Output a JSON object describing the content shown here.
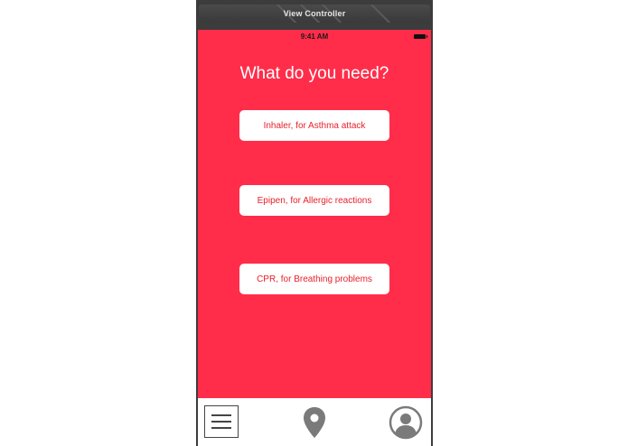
{
  "scene": {
    "title": "View Controller"
  },
  "status_bar": {
    "time": "9:41 AM"
  },
  "main": {
    "title": "What do you need?",
    "buttons": [
      {
        "label": "Inhaler, for Asthma attack"
      },
      {
        "label": "Epipen, for Allergic reactions"
      },
      {
        "label": "CPR, for Breathing problems"
      }
    ]
  },
  "tab_bar": {
    "items": [
      {
        "icon": "hamburger-menu-icon"
      },
      {
        "icon": "map-pin-icon"
      },
      {
        "icon": "user-profile-icon"
      }
    ]
  },
  "colors": {
    "background": "#ff2d4a",
    "button_text": "#e8202a",
    "button_bg": "#ffffff",
    "tab_icon": "#7a7a7a"
  }
}
